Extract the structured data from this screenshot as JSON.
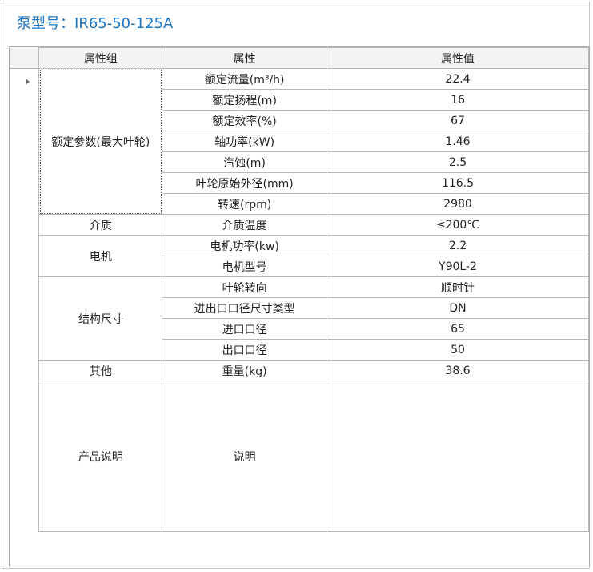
{
  "title": "泵型号：IR65-50-125A",
  "columns": [
    "属性组",
    "属性",
    "属性值"
  ],
  "rows": [
    {
      "group": "额定参数(最大叶轮)",
      "attr": "额定流量(m³/h)",
      "value": "22.4"
    },
    {
      "attr": "额定扬程(m)",
      "value": "16"
    },
    {
      "attr": "额定效率(%)",
      "value": "67"
    },
    {
      "attr": "轴功率(kW)",
      "value": "1.46"
    },
    {
      "attr": "汽蚀(m)",
      "value": "2.5"
    },
    {
      "attr": "叶轮原始外径(mm)",
      "value": "116.5"
    },
    {
      "attr": "转速(rpm)",
      "value": "2980"
    },
    {
      "group": "介质",
      "attr": "介质温度",
      "value": "≤200℃"
    },
    {
      "group": "电机",
      "attr": "电机功率(kw)",
      "value": "2.2"
    },
    {
      "attr": "电机型号",
      "value": "Y90L-2"
    },
    {
      "group": "结构尺寸",
      "attr": "叶轮转向",
      "value": "顺时针"
    },
    {
      "attr": "进出口口径尺寸类型",
      "value": "DN"
    },
    {
      "attr": "进口口径",
      "value": "65"
    },
    {
      "attr": "出口口径",
      "value": "50"
    },
    {
      "group": "其他",
      "attr": "重量(kg)",
      "value": "38.6"
    },
    {
      "group": "产品说明",
      "attr": "说明",
      "value": ""
    }
  ]
}
